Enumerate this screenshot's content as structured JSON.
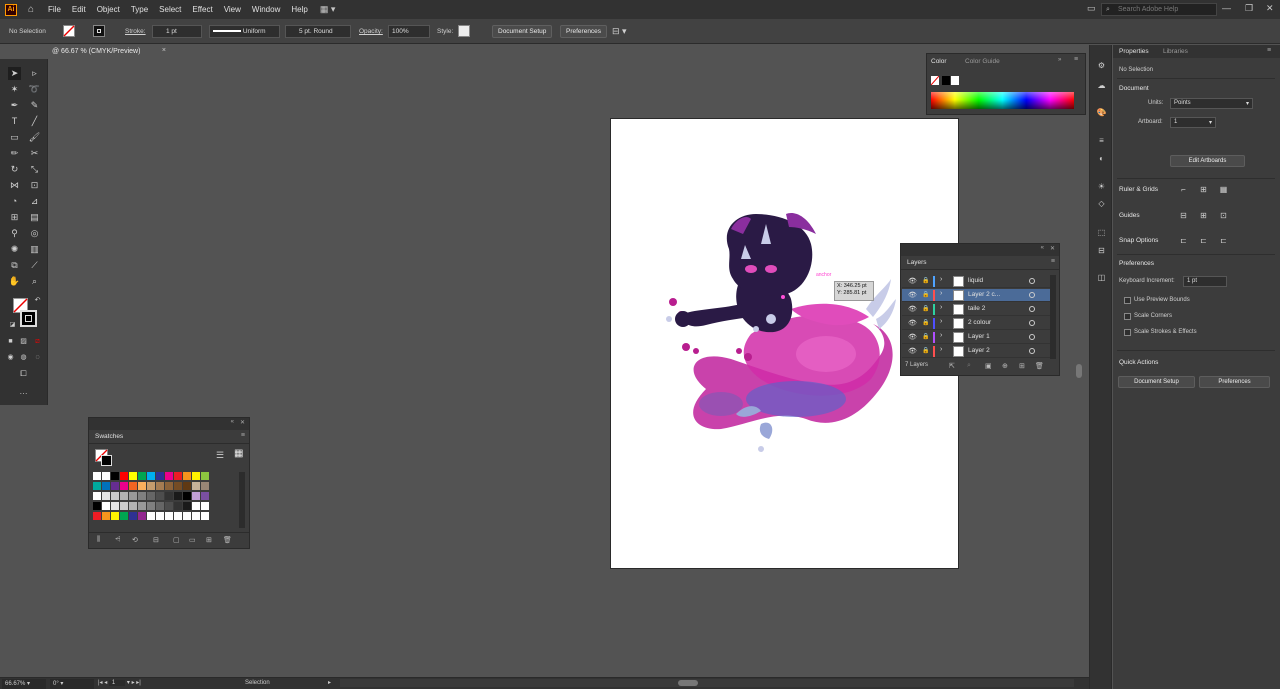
{
  "menubar": {
    "logo": "Ai",
    "items": [
      "File",
      "Edit",
      "Object",
      "Type",
      "Select",
      "Effect",
      "View",
      "Window",
      "Help"
    ],
    "search_placeholder": "Search Adobe Help"
  },
  "controlbar": {
    "selection": "No Selection",
    "stroke_label": "Stroke:",
    "stroke_weight": "1 pt",
    "profile": "Uniform",
    "brush": "5 pt. Round",
    "opacity_label": "Opacity:",
    "opacity": "100%",
    "style_label": "Style:",
    "document_setup": "Document Setup",
    "preferences": "Preferences"
  },
  "document": {
    "tab_title": "@ 66.67 % (CMYK/Preview)"
  },
  "swatches": {
    "title": "Swatches",
    "colors": [
      [
        "#ffffff",
        "#ffffff",
        "#000000",
        "#ff0000",
        "#ffff00",
        "#00a651",
        "#00aeef",
        "#2e3192",
        "#ec008c",
        "#ed1c24",
        "#f7941d",
        "#fff200",
        "#8dc63f"
      ],
      [
        "#00a99d",
        "#0072bc",
        "#662d91",
        "#ec008c",
        "#f26522",
        "#fbaf5d",
        "#c69c6d",
        "#a67c52",
        "#8c6239",
        "#754c24",
        "#603913",
        "#c7b299",
        "#998675"
      ],
      [
        "#ffffff",
        "#e6e6e6",
        "#cccccc",
        "#b3b3b3",
        "#999999",
        "#808080",
        "#666666",
        "#4d4d4d",
        "#333333",
        "#1a1a1a",
        "#000000",
        "#c2a0d6",
        "#7a4fa3"
      ],
      [
        "#000000",
        "#ffffff",
        "#e6e6e6",
        "#cccccc",
        "#b3b3b3",
        "#999999",
        "#808080",
        "#666666",
        "#4d4d4d",
        "#333333",
        "#1a1a1a",
        "#ffffff",
        "#ffffff"
      ],
      [
        "#ed1c24",
        "#f7941d",
        "#fff200",
        "#00a651",
        "#2e3192",
        "#92278f",
        "#ffffff",
        "#ffffff",
        "#ffffff",
        "#ffffff",
        "#ffffff",
        "#ffffff",
        "#ffffff"
      ]
    ]
  },
  "color_panel": {
    "tab_color": "Color",
    "tab_guide": "Color Guide"
  },
  "layers": {
    "title": "Layers",
    "rows": [
      {
        "name": "liquid",
        "color": "#4fa3ff",
        "active": false
      },
      {
        "name": "Layer 2 c...",
        "color": "#ff4f4f",
        "active": true
      },
      {
        "name": "taile 2",
        "color": "#2fd1a0",
        "active": false
      },
      {
        "name": "2 colour",
        "color": "#4f4fff",
        "active": false
      },
      {
        "name": "Layer 1",
        "color": "#b04fff",
        "active": false
      },
      {
        "name": "Layer 2",
        "color": "#ff4f4f",
        "active": false
      }
    ],
    "count": "7 Layers"
  },
  "tooltip": {
    "x": "X: 346.25 pt",
    "y": "Y: 285.81 pt",
    "label": "anchor"
  },
  "properties": {
    "tab_properties": "Properties",
    "tab_libraries": "Libraries",
    "no_selection": "No Selection",
    "document_header": "Document",
    "units_label": "Units:",
    "units_value": "Points",
    "artboard_label": "Artboard:",
    "artboard_value": "1",
    "edit_artboards": "Edit Artboards",
    "ruler_grids": "Ruler & Grids",
    "guides": "Guides",
    "snap_options": "Snap Options",
    "preferences_header": "Preferences",
    "keyboard_increment_label": "Keyboard Increment:",
    "keyboard_increment_value": "1 pt",
    "use_preview_bounds": "Use Preview Bounds",
    "scale_corners": "Scale Corners",
    "scale_strokes": "Scale Strokes & Effects",
    "quick_actions": "Quick Actions",
    "document_setup": "Document Setup",
    "preferences_btn": "Preferences"
  },
  "statusbar": {
    "zoom": "66.67%",
    "rotation": "0°",
    "artboard": "1",
    "tool": "Selection"
  }
}
